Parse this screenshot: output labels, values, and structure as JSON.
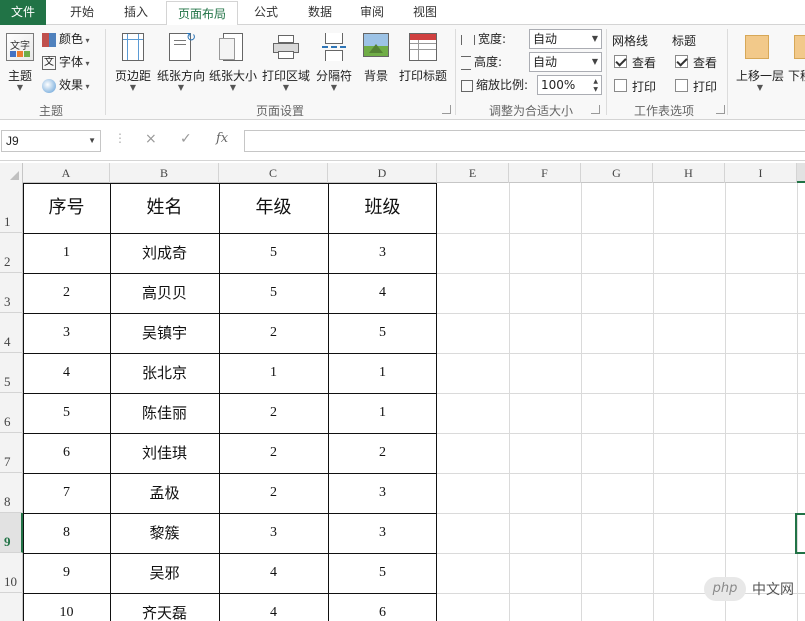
{
  "tabs": [
    {
      "id": "file",
      "label": "文件"
    },
    {
      "id": "home",
      "label": "开始"
    },
    {
      "id": "insert",
      "label": "插入"
    },
    {
      "id": "layout",
      "label": "页面布局"
    },
    {
      "id": "formulas",
      "label": "公式"
    },
    {
      "id": "data",
      "label": "数据"
    },
    {
      "id": "review",
      "label": "审阅"
    },
    {
      "id": "view",
      "label": "视图"
    }
  ],
  "active_tab": "页面布局",
  "ribbon": {
    "themes": {
      "theme_label": "主题",
      "colors_label": "颜色",
      "fonts_label": "字体",
      "effects_label": "效果",
      "group_label": "主题"
    },
    "page_setup": {
      "margins_label": "页边距",
      "orientation_label": "纸张方向",
      "size_label": "纸张大小",
      "print_area_label": "打印区域",
      "breaks_label": "分隔符",
      "background_label": "背景",
      "print_titles_label": "打印标题",
      "group_label": "页面设置"
    },
    "scale_to_fit": {
      "width_label": "宽度:",
      "width_value": "自动",
      "height_label": "高度:",
      "height_value": "自动",
      "scale_label": "缩放比例:",
      "scale_value": "100%",
      "group_label": "调整为合适大小"
    },
    "sheet_options": {
      "gridlines_label": "网格线",
      "headings_label": "标题",
      "view_label": "查看",
      "print_label": "打印",
      "gridlines_view": true,
      "gridlines_print": false,
      "headings_view": true,
      "headings_print": false,
      "group_label": "工作表选项"
    },
    "arrange": {
      "bring_forward_label": "上移一层",
      "send_backward_label": "下移"
    }
  },
  "formula_bar": {
    "name_box": "J9",
    "cancel_icon": "×",
    "enter_icon": "✓",
    "fx_label": "fx",
    "content": ""
  },
  "columns": [
    "A",
    "B",
    "C",
    "D",
    "E",
    "F",
    "G",
    "H",
    "I"
  ],
  "rows": [
    "1",
    "2",
    "3",
    "4",
    "5",
    "6",
    "7",
    "8",
    "9",
    "10"
  ],
  "selected_row": "9",
  "table": {
    "headers": [
      "序号",
      "姓名",
      "年级",
      "班级"
    ],
    "records": [
      [
        "1",
        "刘成奇",
        "5",
        "3"
      ],
      [
        "2",
        "高贝贝",
        "5",
        "4"
      ],
      [
        "3",
        "吴镇宇",
        "2",
        "5"
      ],
      [
        "4",
        "张北京",
        "1",
        "1"
      ],
      [
        "5",
        "陈佳丽",
        "2",
        "1"
      ],
      [
        "6",
        "刘佳琪",
        "2",
        "2"
      ],
      [
        "7",
        "孟极",
        "2",
        "3"
      ],
      [
        "8",
        "黎簇",
        "3",
        "3"
      ],
      [
        "9",
        "吴邪",
        "4",
        "5"
      ],
      [
        "10",
        "齐天磊",
        "4",
        "6"
      ]
    ]
  },
  "watermark": {
    "logo_text": "php",
    "site_text": "中文网"
  },
  "colors": {
    "accent": "#217346",
    "grid": "#dadada",
    "table_border": "#111111"
  }
}
